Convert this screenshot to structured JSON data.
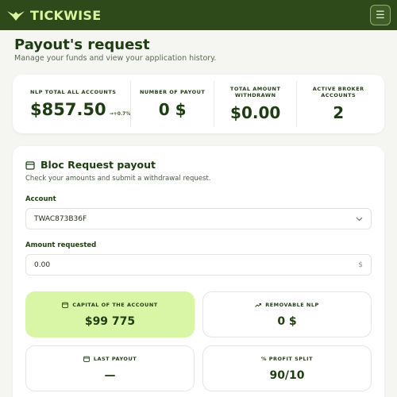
{
  "header": {
    "brand": "TICKWISE",
    "menu_icon": "menu-icon"
  },
  "page": {
    "title": "Payout's request",
    "subtitle": "Manage your funds and view your application history."
  },
  "stats": [
    {
      "label": "NLP TOTAL ALL ACCOUNTS",
      "value": "$857.50",
      "change": "→+0.7%"
    },
    {
      "label": "NUMBER OF PAYOUT",
      "value": "0 $"
    },
    {
      "label": "TOTAL AMOUNT WITHDRAWN",
      "value": "$0.00"
    },
    {
      "label": "ACTIVE BROKER ACCOUNTS",
      "value": "2"
    }
  ],
  "request": {
    "title": "Bloc Request payout",
    "subtitle": "Check your amounts and submit a withdrawal request.",
    "account_label": "Account",
    "account_value": "TWAC873B36F",
    "amount_label": "Amount requested",
    "amount_value": "0.00",
    "amount_suffix": "$"
  },
  "info": [
    {
      "label": "CAPITAL OF THE ACCOUNT",
      "value": "$99 775",
      "icon": "calendar-icon"
    },
    {
      "label": "REMOVABLE NLP",
      "value": "0 $",
      "icon": "trend-up-icon"
    },
    {
      "label": "LAST PAYOUT",
      "value": "—",
      "icon": "calendar-icon"
    },
    {
      "label": "% PROFIT SPLIT",
      "value": "90/10"
    }
  ],
  "colors": {
    "header_bg": "#2e4a1a",
    "brand_accent": "#d9f59d",
    "highlight_card": "#d8f6a6",
    "text_primary": "#1f3d12"
  }
}
